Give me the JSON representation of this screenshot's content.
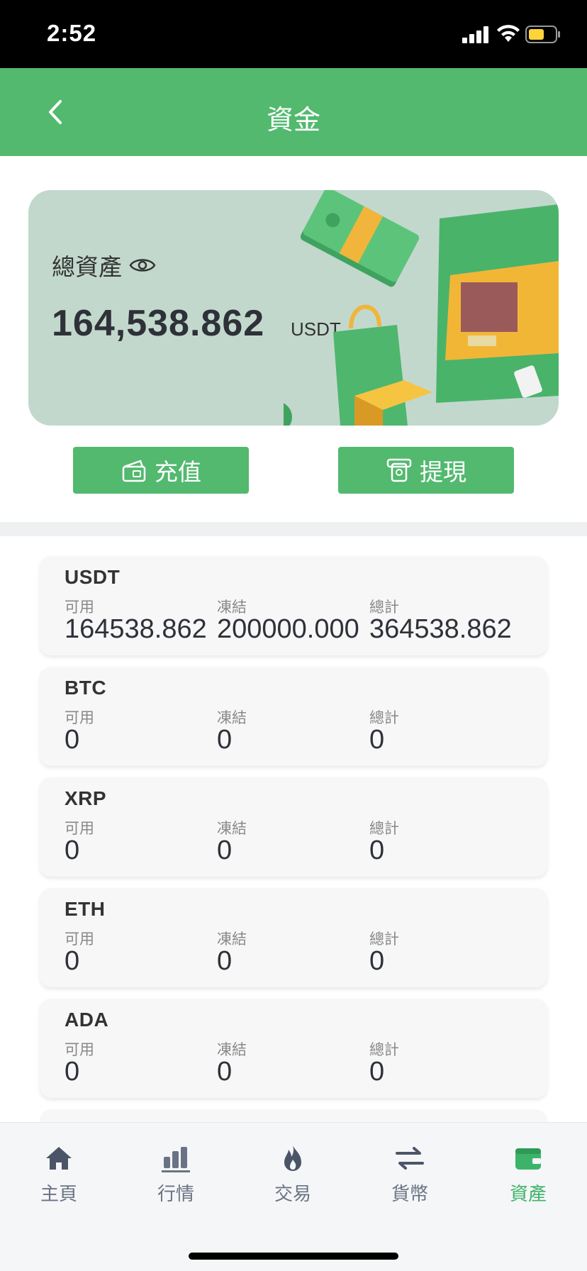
{
  "status_bar": {
    "time": "2:52"
  },
  "header": {
    "title": "資金",
    "back_icon": "chevron-left-icon"
  },
  "asset_summary": {
    "label": "總資產",
    "amount": "164,538.862",
    "unit": "USDT"
  },
  "actions": {
    "deposit_label": "充值",
    "withdraw_label": "提現"
  },
  "coins": [
    {
      "symbol": "USDT",
      "available_label": "可用",
      "available": "164538.862",
      "frozen_label": "凍結",
      "frozen": "200000.000",
      "total_label": "總計",
      "total": "364538.862"
    },
    {
      "symbol": "BTC",
      "available_label": "可用",
      "available": "0",
      "frozen_label": "凍結",
      "frozen": "0",
      "total_label": "總計",
      "total": "0"
    },
    {
      "symbol": "XRP",
      "available_label": "可用",
      "available": "0",
      "frozen_label": "凍結",
      "frozen": "0",
      "total_label": "總計",
      "total": "0"
    },
    {
      "symbol": "ETH",
      "available_label": "可用",
      "available": "0",
      "frozen_label": "凍結",
      "frozen": "0",
      "total_label": "總計",
      "total": "0"
    },
    {
      "symbol": "ADA",
      "available_label": "可用",
      "available": "0",
      "frozen_label": "凍結",
      "frozen": "0",
      "total_label": "總計",
      "total": "0"
    }
  ],
  "nav": [
    {
      "label": "主頁",
      "icon": "home-icon"
    },
    {
      "label": "行情",
      "icon": "bar-chart-icon"
    },
    {
      "label": "交易",
      "icon": "flame-icon"
    },
    {
      "label": "貨幣",
      "icon": "exchange-arrows-icon"
    },
    {
      "label": "資產",
      "icon": "wallet-icon",
      "active": true
    }
  ],
  "colors": {
    "brand": "#52b96f",
    "active_nav": "#3db36a",
    "card_bg": "#c2d8cd"
  }
}
